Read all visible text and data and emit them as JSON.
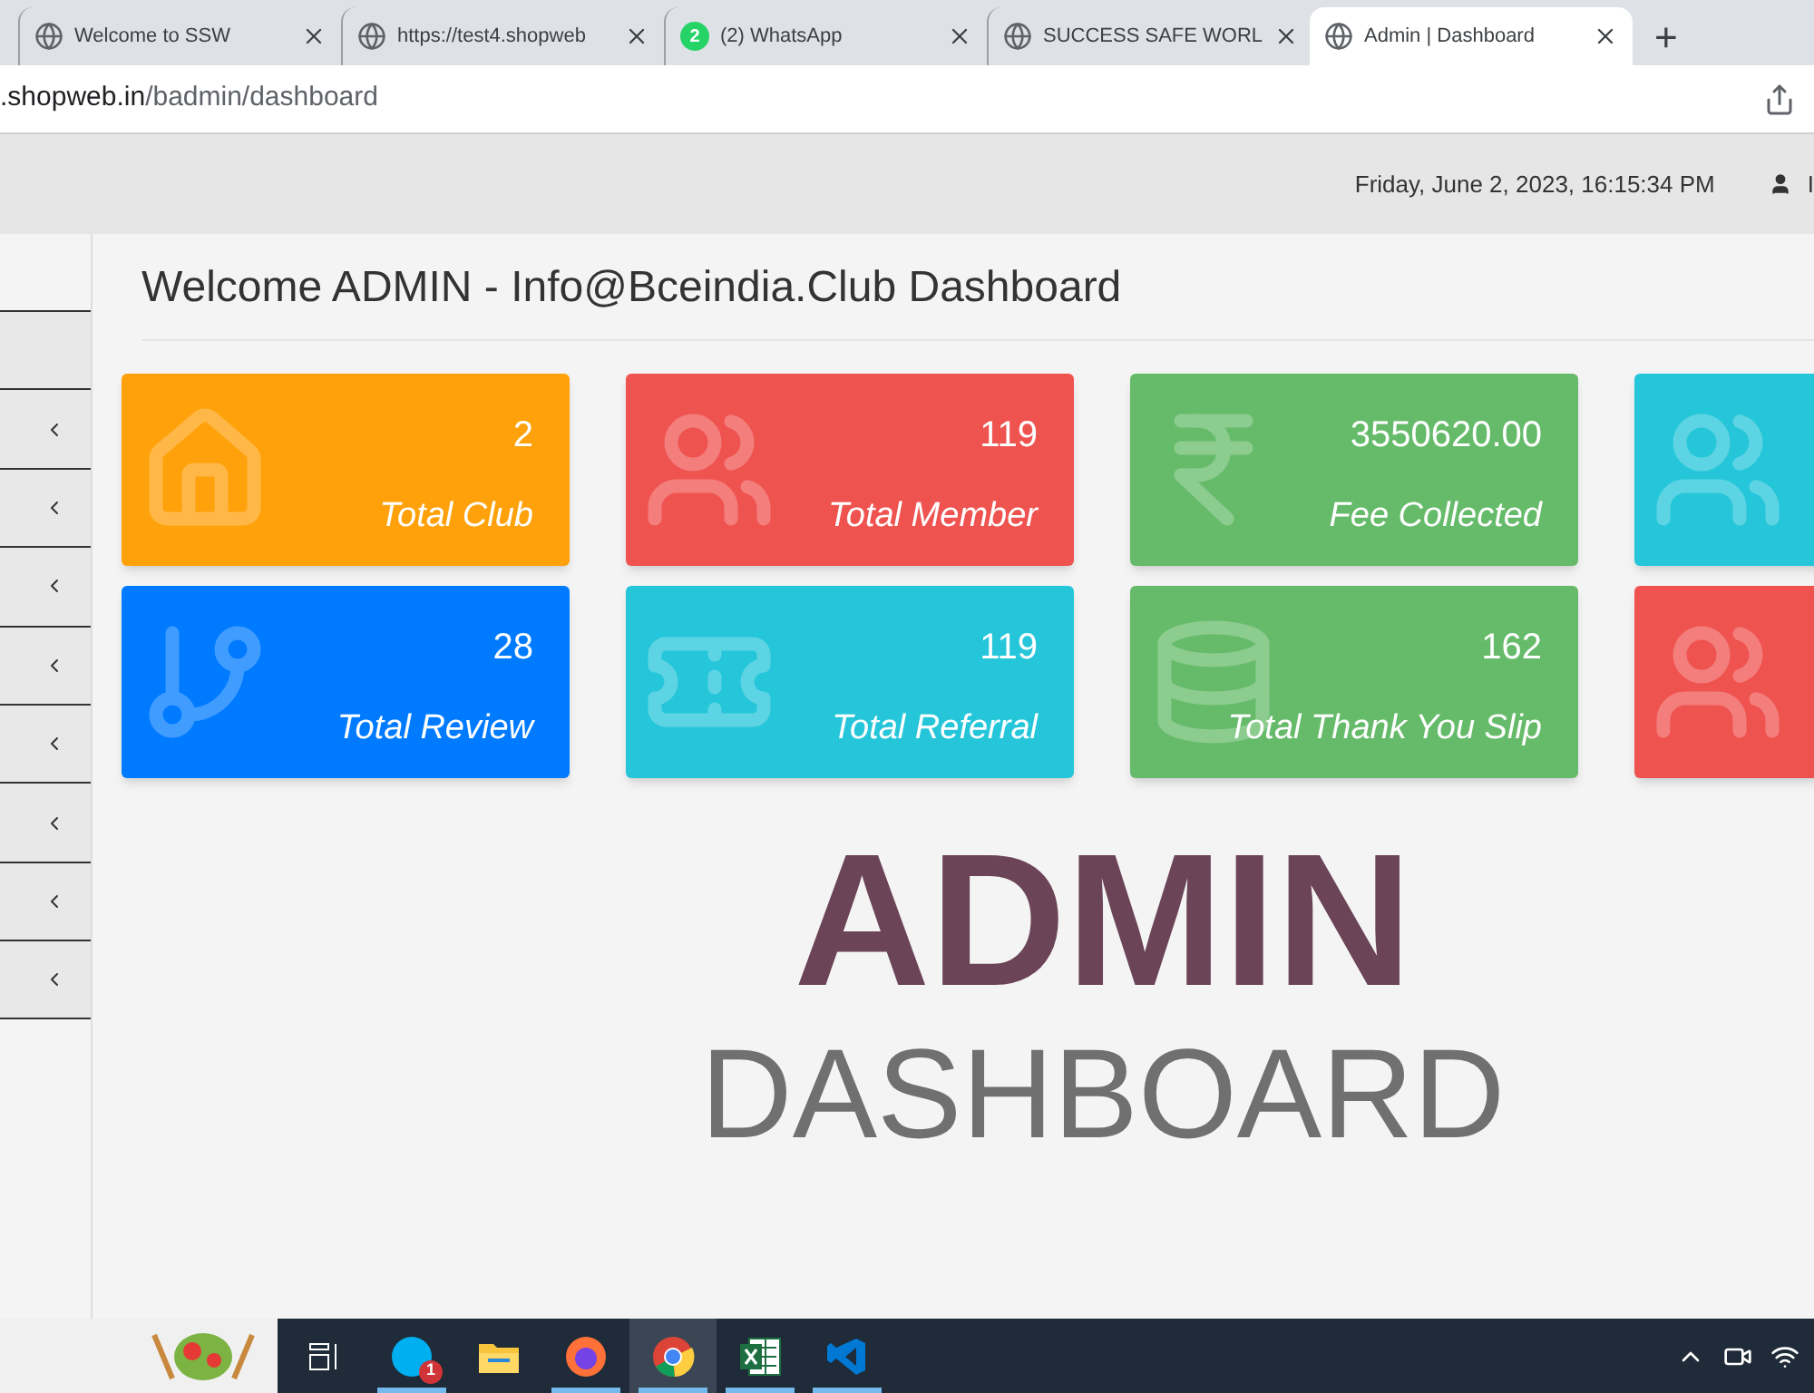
{
  "browser": {
    "tabs": [
      {
        "title": "Welcome to SSW",
        "kind": "globe",
        "selected": false
      },
      {
        "title": "https://test4.shopweb",
        "kind": "globe",
        "selected": false
      },
      {
        "title": "(2) WhatsApp",
        "kind": "badge",
        "badge": "2",
        "selected": false
      },
      {
        "title": "SUCCESS SAFE WORL",
        "kind": "globe",
        "selected": false
      },
      {
        "title": "Admin | Dashboard",
        "kind": "globe",
        "selected": true
      }
    ],
    "new_tab": "+",
    "address": {
      "host": ".shopweb.in",
      "path": "/badmin/dashboard"
    }
  },
  "header": {
    "datetime": "Friday, June 2, 2023, 16:15:34 PM",
    "user": "I"
  },
  "sidebar": {
    "items": [
      {
        "kind": "plain"
      },
      {
        "kind": "chevron"
      },
      {
        "kind": "chevron"
      },
      {
        "kind": "chevron"
      },
      {
        "kind": "chevron"
      },
      {
        "kind": "chevron"
      },
      {
        "kind": "chevron"
      },
      {
        "kind": "chevron"
      },
      {
        "kind": "chevron"
      }
    ]
  },
  "page_title": "Welcome ADMIN - Info@Bceindia.Club Dashboard",
  "cards": [
    {
      "color": "#ffa10a",
      "value": "2",
      "label": "Total Club"
    },
    {
      "color": "#ef5350",
      "value": "119",
      "label": "Total Member"
    },
    {
      "color": "#66bb6a",
      "value": "3550620.00",
      "label": "Fee Collected"
    },
    {
      "color": "#26c6da"
    },
    {
      "color": "#007bff",
      "value": "28",
      "label": "Total Review"
    },
    {
      "color": "#26c6da",
      "value": "119",
      "label": "Total Referral"
    },
    {
      "color": "#66bb6a",
      "value": "162",
      "label": "Total Thank You Slip"
    },
    {
      "color": "#ef5350"
    }
  ],
  "banner": {
    "title": "ADMIN",
    "subtitle": "DASHBOARD"
  },
  "taskbar": {
    "apps": [
      {
        "running": false,
        "selected": false
      },
      {
        "badge": "1",
        "running": true,
        "selected": false
      },
      {
        "running": false,
        "selected": false
      },
      {
        "running": true,
        "selected": false
      },
      {
        "running": true,
        "selected": true
      },
      {
        "running": true,
        "selected": false
      },
      {
        "running": true,
        "selected": false
      }
    ]
  }
}
